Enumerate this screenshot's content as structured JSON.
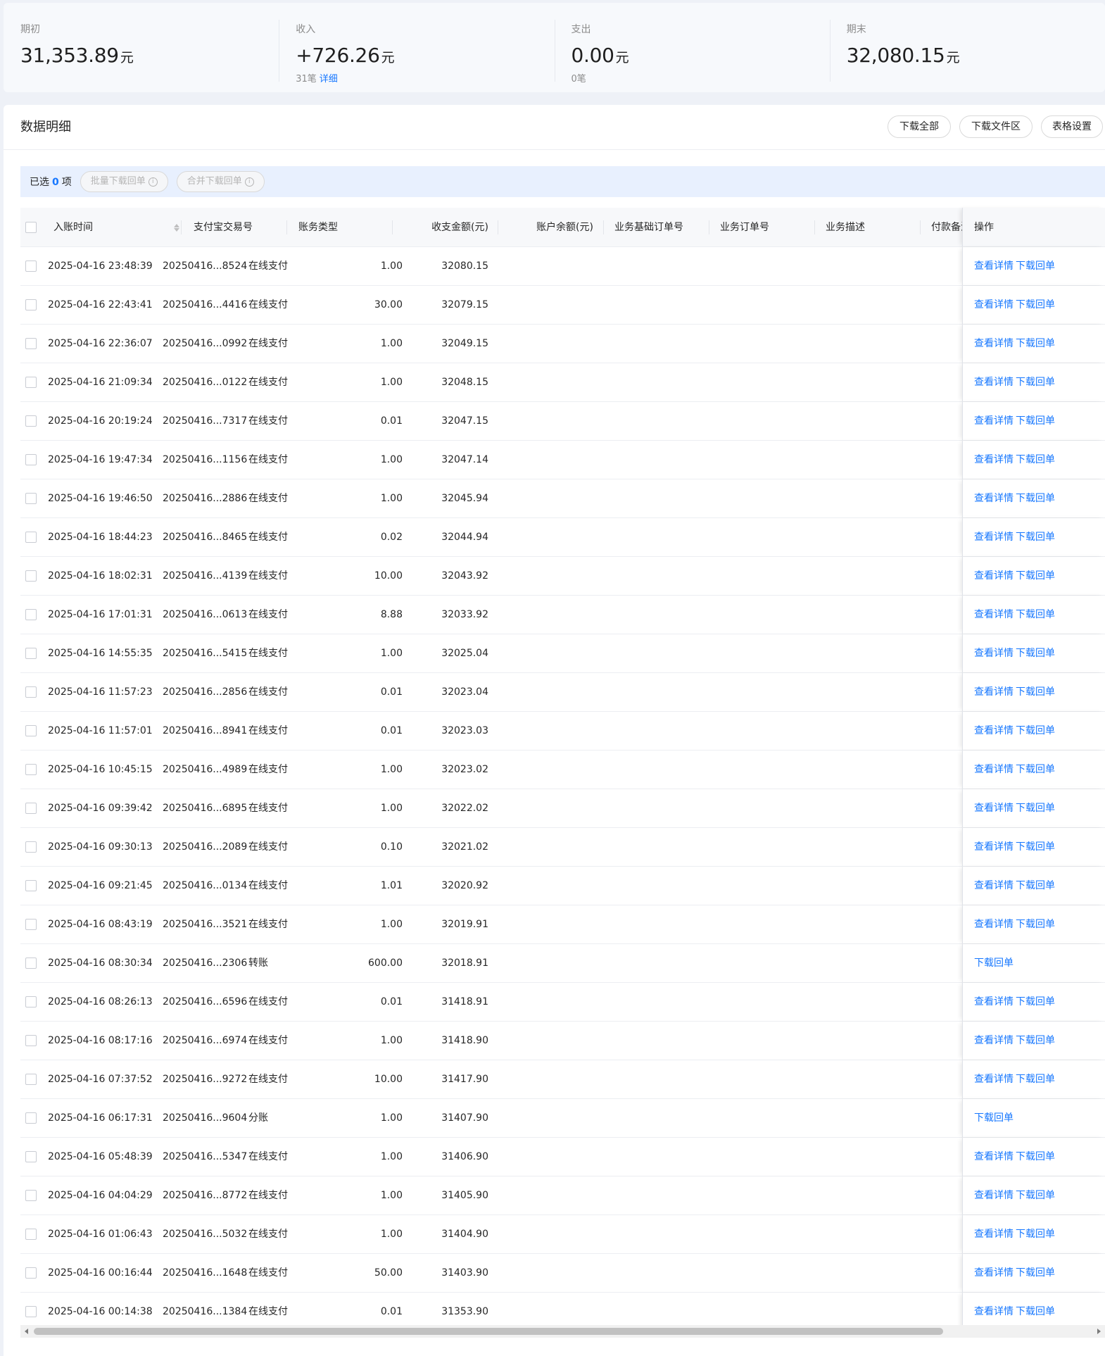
{
  "summary": [
    {
      "label": "期初",
      "value": "31,353.89",
      "unit": "元",
      "sub_count": "",
      "sub_link": ""
    },
    {
      "label": "收入",
      "value": "+726.26",
      "unit": "元",
      "sub_count": "31笔",
      "sub_link": "详细"
    },
    {
      "label": "支出",
      "value": "0.00",
      "unit": "元",
      "sub_count": "0笔",
      "sub_link": ""
    },
    {
      "label": "期末",
      "value": "32,080.15",
      "unit": "元",
      "sub_count": "",
      "sub_link": ""
    }
  ],
  "panel": {
    "title": "数据明细",
    "buttons": {
      "download_all": "下载全部",
      "download_area": "下载文件区",
      "table_settings": "表格设置"
    }
  },
  "selection": {
    "prefix": "已选",
    "count": "0",
    "suffix": "项",
    "batch_download": "批量下载回单",
    "merge_download": "合并下载回单"
  },
  "table": {
    "columns": {
      "time": "入账时间",
      "trade_no": "支付宝交易号",
      "type": "账务类型",
      "amount": "收支金额(元)",
      "balance": "账户余额(元)",
      "base_order": "业务基础订单号",
      "order": "业务订单号",
      "desc": "业务描述",
      "payer": "付款备注",
      "ops": "操作"
    },
    "links": {
      "view": "查看详情",
      "download": "下载回单"
    },
    "rows": [
      {
        "time": "2025-04-16 23:48:39",
        "trade_no": "20250416...8524",
        "type": "在线支付",
        "amount": "1.00",
        "balance": "32080.15",
        "view": true
      },
      {
        "time": "2025-04-16 22:43:41",
        "trade_no": "20250416...4416",
        "type": "在线支付",
        "amount": "30.00",
        "balance": "32079.15",
        "view": true
      },
      {
        "time": "2025-04-16 22:36:07",
        "trade_no": "20250416...0992",
        "type": "在线支付",
        "amount": "1.00",
        "balance": "32049.15",
        "view": true
      },
      {
        "time": "2025-04-16 21:09:34",
        "trade_no": "20250416...0122",
        "type": "在线支付",
        "amount": "1.00",
        "balance": "32048.15",
        "view": true
      },
      {
        "time": "2025-04-16 20:19:24",
        "trade_no": "20250416...7317",
        "type": "在线支付",
        "amount": "0.01",
        "balance": "32047.15",
        "view": true
      },
      {
        "time": "2025-04-16 19:47:34",
        "trade_no": "20250416...1156",
        "type": "在线支付",
        "amount": "1.00",
        "balance": "32047.14",
        "view": true
      },
      {
        "time": "2025-04-16 19:46:50",
        "trade_no": "20250416...2886",
        "type": "在线支付",
        "amount": "1.00",
        "balance": "32045.94",
        "view": true
      },
      {
        "time": "2025-04-16 18:44:23",
        "trade_no": "20250416...8465",
        "type": "在线支付",
        "amount": "0.02",
        "balance": "32044.94",
        "view": true
      },
      {
        "time": "2025-04-16 18:02:31",
        "trade_no": "20250416...4139",
        "type": "在线支付",
        "amount": "10.00",
        "balance": "32043.92",
        "view": true
      },
      {
        "time": "2025-04-16 17:01:31",
        "trade_no": "20250416...0613",
        "type": "在线支付",
        "amount": "8.88",
        "balance": "32033.92",
        "view": true
      },
      {
        "time": "2025-04-16 14:55:35",
        "trade_no": "20250416...5415",
        "type": "在线支付",
        "amount": "1.00",
        "balance": "32025.04",
        "view": true
      },
      {
        "time": "2025-04-16 11:57:23",
        "trade_no": "20250416...2856",
        "type": "在线支付",
        "amount": "0.01",
        "balance": "32023.04",
        "view": true
      },
      {
        "time": "2025-04-16 11:57:01",
        "trade_no": "20250416...8941",
        "type": "在线支付",
        "amount": "0.01",
        "balance": "32023.03",
        "view": true
      },
      {
        "time": "2025-04-16 10:45:15",
        "trade_no": "20250416...4989",
        "type": "在线支付",
        "amount": "1.00",
        "balance": "32023.02",
        "view": true
      },
      {
        "time": "2025-04-16 09:39:42",
        "trade_no": "20250416...6895",
        "type": "在线支付",
        "amount": "1.00",
        "balance": "32022.02",
        "view": true
      },
      {
        "time": "2025-04-16 09:30:13",
        "trade_no": "20250416...2089",
        "type": "在线支付",
        "amount": "0.10",
        "balance": "32021.02",
        "view": true
      },
      {
        "time": "2025-04-16 09:21:45",
        "trade_no": "20250416...0134",
        "type": "在线支付",
        "amount": "1.01",
        "balance": "32020.92",
        "view": true
      },
      {
        "time": "2025-04-16 08:43:19",
        "trade_no": "20250416...3521",
        "type": "在线支付",
        "amount": "1.00",
        "balance": "32019.91",
        "view": true
      },
      {
        "time": "2025-04-16 08:30:34",
        "trade_no": "20250416...2306",
        "type": "转账",
        "amount": "600.00",
        "balance": "32018.91",
        "view": false
      },
      {
        "time": "2025-04-16 08:26:13",
        "trade_no": "20250416...6596",
        "type": "在线支付",
        "amount": "0.01",
        "balance": "31418.91",
        "view": true
      },
      {
        "time": "2025-04-16 08:17:16",
        "trade_no": "20250416...6974",
        "type": "在线支付",
        "amount": "1.00",
        "balance": "31418.90",
        "view": true
      },
      {
        "time": "2025-04-16 07:37:52",
        "trade_no": "20250416...9272",
        "type": "在线支付",
        "amount": "10.00",
        "balance": "31417.90",
        "view": true
      },
      {
        "time": "2025-04-16 06:17:31",
        "trade_no": "20250416...9604",
        "type": "分账",
        "amount": "1.00",
        "balance": "31407.90",
        "view": false
      },
      {
        "time": "2025-04-16 05:48:39",
        "trade_no": "20250416...5347",
        "type": "在线支付",
        "amount": "1.00",
        "balance": "31406.90",
        "view": true
      },
      {
        "time": "2025-04-16 04:04:29",
        "trade_no": "20250416...8772",
        "type": "在线支付",
        "amount": "1.00",
        "balance": "31405.90",
        "view": true
      },
      {
        "time": "2025-04-16 01:06:43",
        "trade_no": "20250416...5032",
        "type": "在线支付",
        "amount": "1.00",
        "balance": "31404.90",
        "view": true
      },
      {
        "time": "2025-04-16 00:16:44",
        "trade_no": "20250416...1648",
        "type": "在线支付",
        "amount": "50.00",
        "balance": "31403.90",
        "view": true
      },
      {
        "time": "2025-04-16 00:14:38",
        "trade_no": "20250416...1384",
        "type": "在线支付",
        "amount": "0.01",
        "balance": "31353.90",
        "view": true
      }
    ]
  },
  "colors": {
    "link": "#1677ff",
    "header_bg": "#f7f8fa",
    "selection_bg": "#e8f0fe"
  }
}
